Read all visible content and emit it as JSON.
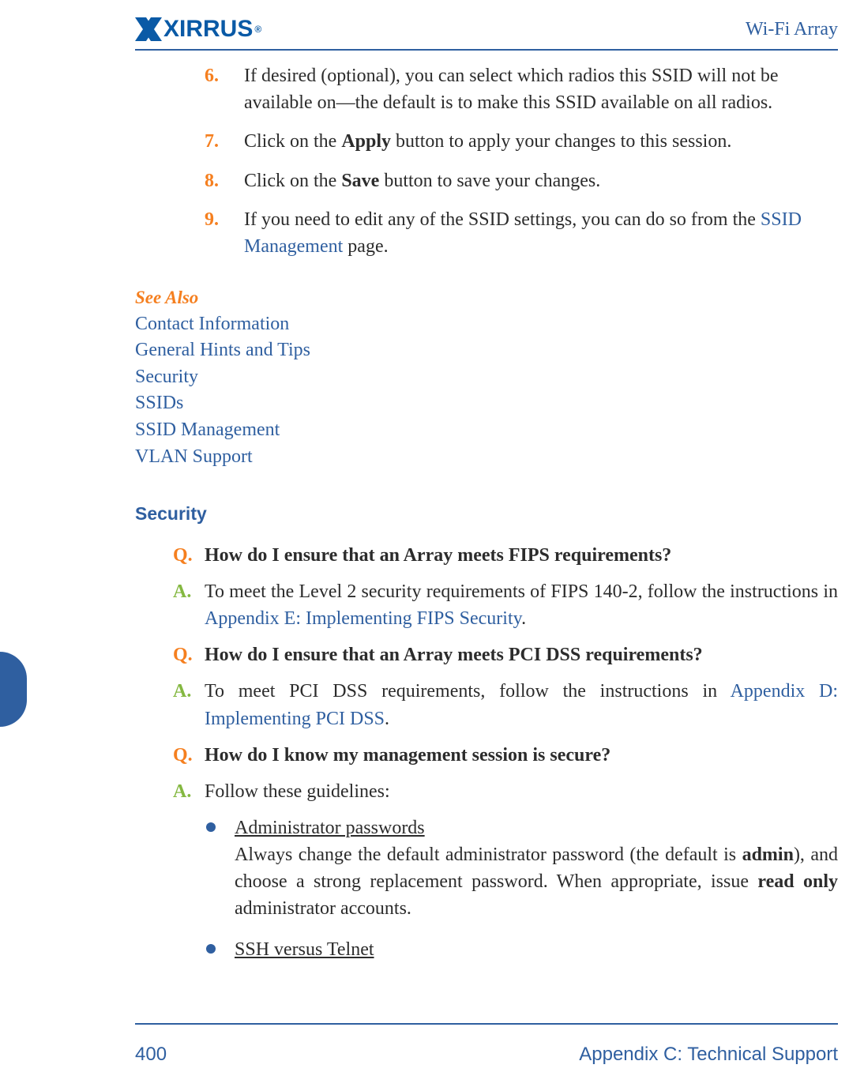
{
  "header": {
    "logo_text": "XIRRUS",
    "doc_title": "Wi-Fi Array"
  },
  "steps": [
    {
      "num": "6.",
      "text_parts": [
        {
          "t": "If desired (optional), you can select which radios this SSID will not be available on—the default is to make this SSID available on all radios."
        }
      ]
    },
    {
      "num": "7.",
      "text_parts": [
        {
          "t": "Click on the "
        },
        {
          "t": "Apply",
          "bold": true
        },
        {
          "t": " button to apply your changes to this session."
        }
      ]
    },
    {
      "num": "8.",
      "text_parts": [
        {
          "t": "Click on the "
        },
        {
          "t": "Save",
          "bold": true
        },
        {
          "t": " button to save your changes."
        }
      ]
    },
    {
      "num": "9.",
      "text_parts": [
        {
          "t": "If you need to edit any of the SSID settings, you can do so from the "
        },
        {
          "t": "SSID Management",
          "link": true
        },
        {
          "t": " page."
        }
      ]
    }
  ],
  "see_also": {
    "title": "See Also",
    "items": [
      "Contact Information",
      "General Hints and Tips",
      "Security",
      "SSIDs",
      "SSID Management",
      "VLAN Support"
    ]
  },
  "section_heading": "Security",
  "qa": [
    {
      "label": "Q.",
      "cls": "q",
      "parts": [
        {
          "t": "How do I ensure that an Array meets FIPS requirements?",
          "bold": true
        }
      ]
    },
    {
      "label": "A.",
      "cls": "a",
      "parts": [
        {
          "t": "To meet the Level 2 security requirements of FIPS 140-2, follow the instructions in "
        },
        {
          "t": "Appendix E: Implementing FIPS Security",
          "link": true
        },
        {
          "t": "."
        }
      ]
    },
    {
      "label": "Q.",
      "cls": "q",
      "parts": [
        {
          "t": "How do I ensure that an Array meets PCI DSS requirements?",
          "bold": true
        }
      ]
    },
    {
      "label": "A.",
      "cls": "a",
      "parts": [
        {
          "t": "To meet PCI DSS requirements, follow the instructions in "
        },
        {
          "t": "Appendix D: Implementing PCI DSS",
          "link": true
        },
        {
          "t": "."
        }
      ]
    },
    {
      "label": "Q.",
      "cls": "q",
      "parts": [
        {
          "t": "How do I know my management session is secure?",
          "bold": true
        }
      ]
    },
    {
      "label": "A.",
      "cls": "a",
      "parts": [
        {
          "t": "Follow these guidelines:"
        }
      ]
    }
  ],
  "bullets": [
    {
      "title": "Administrator passwords",
      "body_parts": [
        {
          "t": "Always change the default administrator password (the default is "
        },
        {
          "t": "admin",
          "bold": true
        },
        {
          "t": "), and choose a strong replacement password. When appropriate, issue "
        },
        {
          "t": "read only",
          "bold": true
        },
        {
          "t": " administrator accounts."
        }
      ]
    },
    {
      "title": "SSH versus Telnet",
      "body_parts": []
    }
  ],
  "footer": {
    "page": "400",
    "section": "Appendix C: Technical Support"
  }
}
